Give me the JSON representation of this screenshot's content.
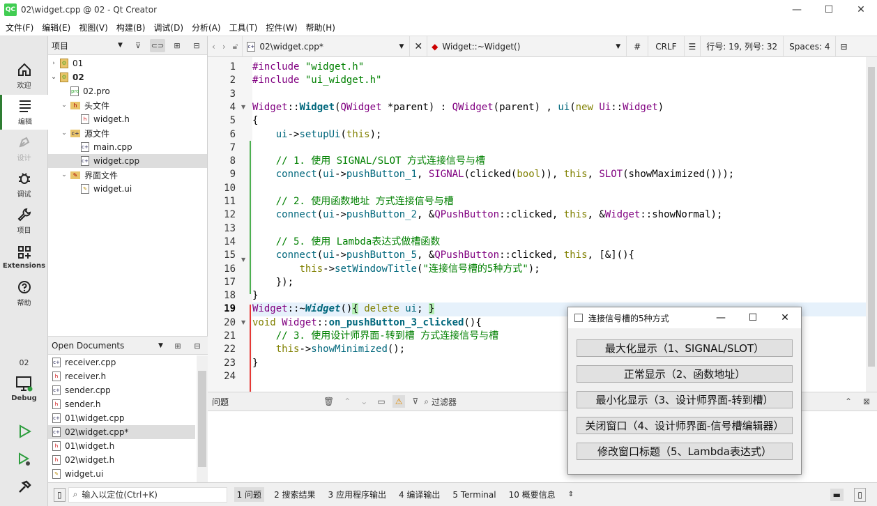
{
  "window": {
    "logo": "QC",
    "title": "02\\widget.cpp @ 02 - Qt Creator",
    "min": "—",
    "max": "☐",
    "close": "✕"
  },
  "menus": [
    "文件(F)",
    "编辑(E)",
    "视图(V)",
    "构建(B)",
    "调试(D)",
    "分析(A)",
    "工具(T)",
    "控件(W)",
    "帮助(H)"
  ],
  "modes": {
    "welcome": "欢迎",
    "edit": "编辑",
    "design": "设计",
    "debug": "调试",
    "projects": "项目",
    "extensions": "Extensions",
    "help": "帮助",
    "kit": "02",
    "kit_mode": "Debug"
  },
  "project_panel": {
    "title": "项目",
    "tree": [
      {
        "label": "01",
        "level": 0,
        "arrow": "›",
        "icon": "proj"
      },
      {
        "label": "02",
        "level": 0,
        "arrow": "⌄",
        "icon": "proj",
        "bold": true
      },
      {
        "label": "02.pro",
        "level": 1,
        "arrow": "",
        "icon": "pro"
      },
      {
        "label": "头文件",
        "level": 1,
        "arrow": "⌄",
        "icon": "folder-h"
      },
      {
        "label": "widget.h",
        "level": 2,
        "arrow": "",
        "icon": "h"
      },
      {
        "label": "源文件",
        "level": 1,
        "arrow": "⌄",
        "icon": "folder-c"
      },
      {
        "label": "main.cpp",
        "level": 2,
        "arrow": "",
        "icon": "cpp"
      },
      {
        "label": "widget.cpp",
        "level": 2,
        "arrow": "",
        "icon": "cpp",
        "selected": true
      },
      {
        "label": "界面文件",
        "level": 1,
        "arrow": "⌄",
        "icon": "folder-ui"
      },
      {
        "label": "widget.ui",
        "level": 2,
        "arrow": "",
        "icon": "ui"
      }
    ]
  },
  "open_documents": {
    "title": "Open Documents",
    "items": [
      "receiver.cpp",
      "receiver.h",
      "sender.cpp",
      "sender.h",
      "01\\widget.cpp",
      "02\\widget.cpp*",
      "01\\widget.h",
      "02\\widget.h",
      "widget.ui"
    ],
    "selected_index": 5
  },
  "editor_bar": {
    "file": "02\\widget.cpp*",
    "symbol": "Widget::~Widget()",
    "hash": "#",
    "eol": "CRLF",
    "position": "行号: 19, 列号: 32",
    "spaces": "Spaces: 4"
  },
  "editor": {
    "current_line": 19,
    "lines": [
      "1",
      "2",
      "3",
      "4",
      "5",
      "6",
      "7",
      "8",
      "9",
      "10",
      "11",
      "12",
      "13",
      "14",
      "15",
      "16",
      "17",
      "18",
      "19",
      "20",
      "21",
      "22",
      "23",
      "24"
    ]
  },
  "issues": {
    "title": "问题",
    "filter_placeholder": "过滤器"
  },
  "statusbar": {
    "locator": "输入以定位(Ctrl+K)",
    "tabs": [
      "1  问题",
      "2  搜索结果",
      "3  应用程序输出",
      "4  编译输出",
      "5  Terminal",
      "10  概要信息"
    ]
  },
  "dialog": {
    "title": "连接信号槽的5种方式",
    "buttons": [
      "最大化显示（1、SIGNAL/SLOT）",
      "正常显示（2、函数地址）",
      "最小化显示（3、设计师界面-转到槽）",
      "关闭窗口（4、设计师界面-信号槽编辑器）",
      "修改窗口标题（5、Lambda表达式）"
    ]
  }
}
